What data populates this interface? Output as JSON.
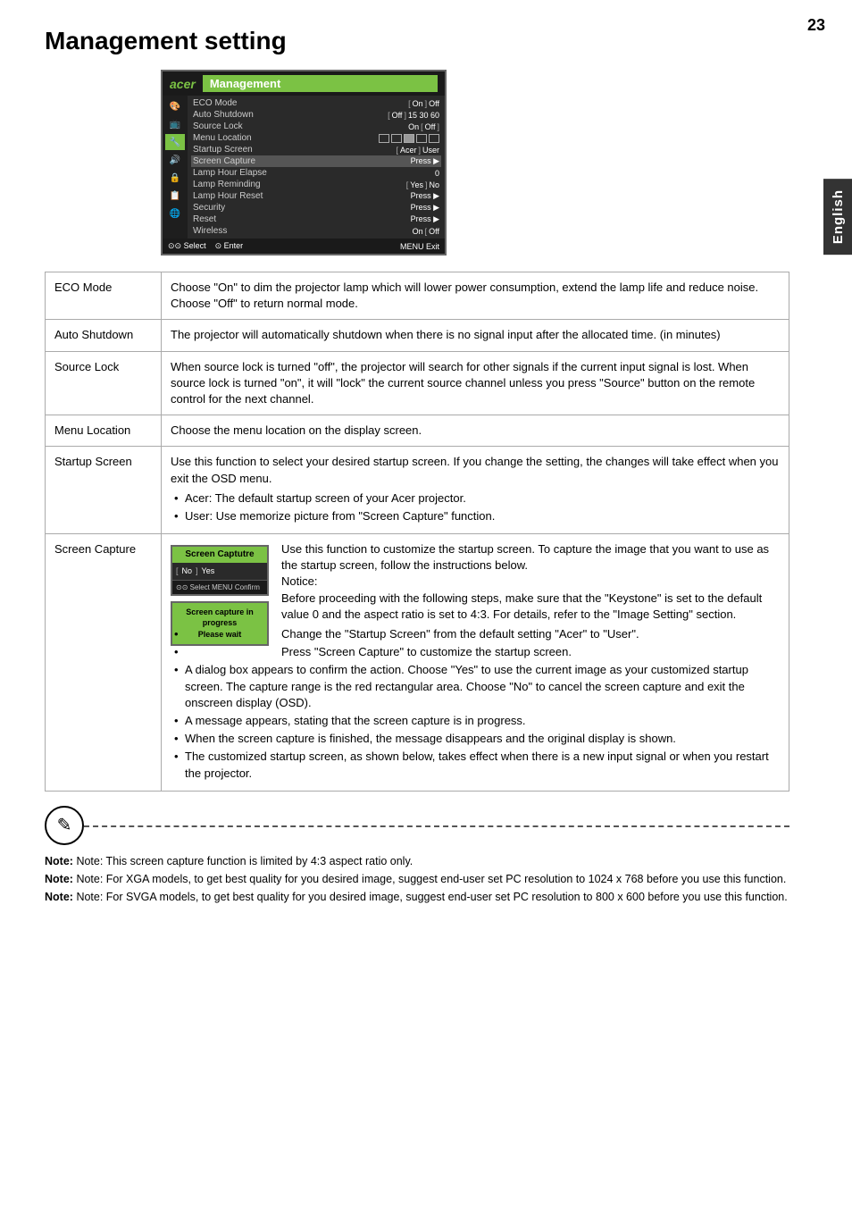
{
  "page": {
    "number": "23",
    "title": "Management setting",
    "sidebar_label": "English"
  },
  "osd": {
    "logo": "acer",
    "title": "Management",
    "icons": [
      "🎨",
      "📺",
      "🔧",
      "🔊",
      "🔒",
      "📋",
      "🌐"
    ],
    "rows": [
      {
        "label": "ECO Mode",
        "value": "On  [  Off  ]"
      },
      {
        "label": "Auto Shutdown",
        "value": "[  Off  ]  15  30  60"
      },
      {
        "label": "Source Lock",
        "value": "On  [  Off  ]"
      },
      {
        "label": "Menu Location",
        "value": "□ □ ■ □ □"
      },
      {
        "label": "Startup Screen",
        "value": "[  Acer  ]  User"
      },
      {
        "label": "Screen Capture",
        "value": "Press  ▶"
      },
      {
        "label": "Lamp Hour Elapse",
        "value": "0"
      },
      {
        "label": "Lamp Reminding",
        "value": "[  Yes  ]  No"
      },
      {
        "label": "Lamp Hour Reset",
        "value": "Press  ▶"
      },
      {
        "label": "Security",
        "value": "Press  ▶"
      },
      {
        "label": "Reset",
        "value": "Press  ▶"
      },
      {
        "label": "Wireless",
        "value": "On  [  Off"
      }
    ],
    "footer": {
      "select": "⊙⊙ Select",
      "enter": "⊙ Enter",
      "exit": "MENU Exit"
    }
  },
  "table": {
    "rows": [
      {
        "label": "ECO Mode",
        "description": "Choose \"On\" to dim the projector lamp which will lower power consumption, extend the lamp life and reduce noise.  Choose \"Off\" to return normal mode."
      },
      {
        "label": "Auto Shutdown",
        "description": "The projector will automatically shutdown when there is no signal input after the allocated time. (in minutes)"
      },
      {
        "label": "Source Lock",
        "description": "When source lock is turned \"off\", the projector will search for other signals if the current input signal is lost. When source lock is turned \"on\", it will \"lock\" the current source channel unless you press \"Source\" button on the remote control for the next channel."
      },
      {
        "label": "Menu Location",
        "description": "Choose the menu location on the display screen."
      },
      {
        "label": "Startup Screen",
        "description": "Use this function to select your desired startup screen. If you change the setting, the changes will take effect when you exit the OSD menu.",
        "bullets": [
          "Acer: The default startup screen of your Acer projector.",
          "User: Use memorize picture from \"Screen Capture\" function."
        ]
      },
      {
        "label": "Screen Capture",
        "description": "Use this function to customize the startup screen. To capture the image that you want to use as the startup screen, follow the instructions below.\nNotice:\nBefore proceeding with the following steps, make sure that the \"Keystone\" is set to the default value 0 and the aspect ratio is set to 4:3. For details, refer to the \"Image Setting\" section.",
        "bullets": [
          "Change the \"Startup Screen\" from the default setting \"Acer\" to \"User\".",
          "Press \"Screen Capture\" to customize the startup screen.",
          "A dialog box appears to confirm the action. Choose \"Yes\" to use the current image as your customized startup screen. The capture range is the red rectangular area. Choose \"No\" to cancel the screen capture and exit the onscreen display (OSD).",
          "A message appears, stating that the screen capture is in progress.",
          "When the screen capture is finished, the message disappears and the original display is shown.",
          "The customized startup screen, as shown below, takes effect when there is a new input signal or when you restart the projector."
        ],
        "has_inset": true
      }
    ]
  },
  "screen_capture_inset": {
    "title": "Screen Captutre",
    "option_no": "No",
    "option_yes": "Yes",
    "footer": "⊙⊙ Select    MENU Confirm",
    "progress_line1": "Screen capture in progress",
    "progress_line2": "Please wait"
  },
  "notes": [
    "Note: This screen capture function is limited by 4:3 aspect ratio only.",
    "Note: For XGA models, to get best quality for you desired image, suggest end-user set PC resolution to 1024 x 768 before you use this function.",
    "Note: For SVGA models, to get best quality for you desired image, suggest end-user set PC resolution to 800 x 600 before you use this function."
  ]
}
